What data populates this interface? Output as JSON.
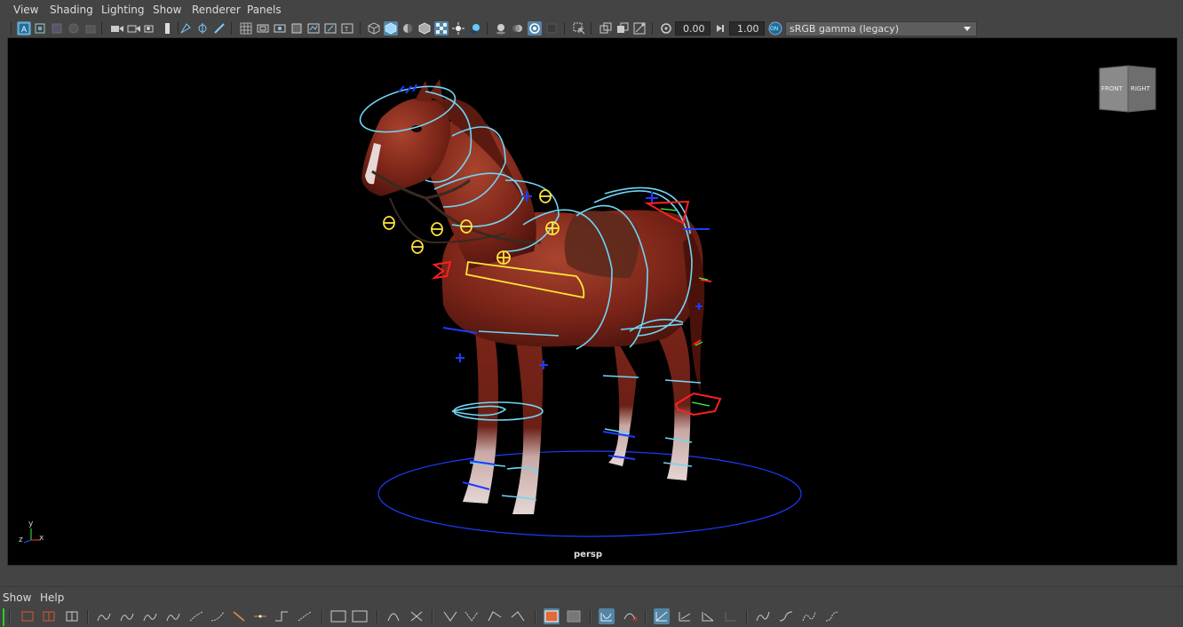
{
  "menu": {
    "view": "View",
    "shading": "Shading",
    "lighting": "Lighting",
    "show": "Show",
    "renderer": "Renderer",
    "panels": "Panels"
  },
  "toolbar": {
    "exposure_value": "0.00",
    "gamma_value": "1.00",
    "color_space": "sRGB gamma (legacy)",
    "color_mgmt_badge": "ON"
  },
  "viewport": {
    "camera_label": "persp",
    "viewcube_front": "FRONT",
    "viewcube_right": "RIGHT",
    "axis_x": "x",
    "axis_y": "y",
    "axis_z": "z"
  },
  "graph_menu": {
    "show": "Show",
    "help": "Help"
  },
  "colors": {
    "panel_bg": "#444444",
    "viewport_bg": "#000000",
    "active_button": "#5285a6",
    "control_cyan": "#6fd6f5",
    "control_blue": "#1c3cff",
    "control_yellow": "#ffe33a",
    "control_red": "#ff2020",
    "horse_body": "#7a2418"
  }
}
